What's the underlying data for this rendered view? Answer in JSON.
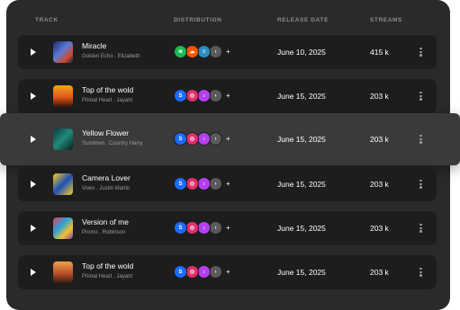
{
  "header": {
    "track": "TRACK",
    "distribution": "DISTRIBUTION",
    "release_date": "RELEASE DATE",
    "streams": "STREAMS"
  },
  "tracks": [
    {
      "title": "Miracle",
      "album": "Golden Echo",
      "artist": "Elizabeth",
      "release_date": "June 10, 2025",
      "streams": "415 k",
      "platforms": [
        "spotify-icon",
        "soundcloud-icon",
        "deezer-icon",
        "more-platforms-icon"
      ],
      "more_label": "+",
      "art": "blue-night-portrait"
    },
    {
      "title": "Top of the wold",
      "album": "Primal Heart",
      "artist": "Jayant",
      "release_date": "June 15, 2025",
      "streams": "203 k",
      "platforms": [
        "shazam-icon",
        "instagram-icon",
        "itunes-icon",
        "more-platforms-icon"
      ],
      "more_label": "+",
      "art": "sunset-figure"
    },
    {
      "title": "Yellow Flower",
      "album": "Sundown",
      "artist": "Country Harry",
      "release_date": "June 15, 2025",
      "streams": "203 k",
      "platforms": [
        "shazam-icon",
        "instagram-icon",
        "itunes-icon",
        "more-platforms-icon"
      ],
      "more_label": "+",
      "art": "teal-portrait"
    },
    {
      "title": "Camera Lover",
      "album": "Vows",
      "artist": "Justin Martin",
      "release_date": "June 15, 2025",
      "streams": "203 k",
      "platforms": [
        "shazam-icon",
        "instagram-icon",
        "itunes-icon",
        "more-platforms-icon"
      ],
      "more_label": "+",
      "art": "yellow-pop-art"
    },
    {
      "title": "Version of me",
      "album": "Promo",
      "artist": "Robinson",
      "release_date": "June 15, 2025",
      "streams": "203 k",
      "platforms": [
        "shazam-icon",
        "instagram-icon",
        "itunes-icon",
        "more-platforms-icon"
      ],
      "more_label": "+",
      "art": "colorful-face"
    },
    {
      "title": "Top of the wold",
      "album": "Primal Heart",
      "artist": "Jayant",
      "release_date": "June 15, 2025",
      "streams": "203 k",
      "platforms": [
        "shazam-icon",
        "instagram-icon",
        "itunes-icon",
        "more-platforms-icon"
      ],
      "more_label": "+",
      "art": "guitar-player"
    }
  ],
  "separator": ".",
  "colors": {
    "panel": "#2a2a2a",
    "row": "#1d1d1d",
    "highlight_row": "#3a3a3a",
    "spotify": "#1db954",
    "soundcloud": "#ff5500",
    "deezer": "#2b8cc4",
    "shazam": "#1b6bff",
    "instagram": "#e1306c",
    "itunes": "#b43ff0",
    "more": "#5a5a5a"
  }
}
